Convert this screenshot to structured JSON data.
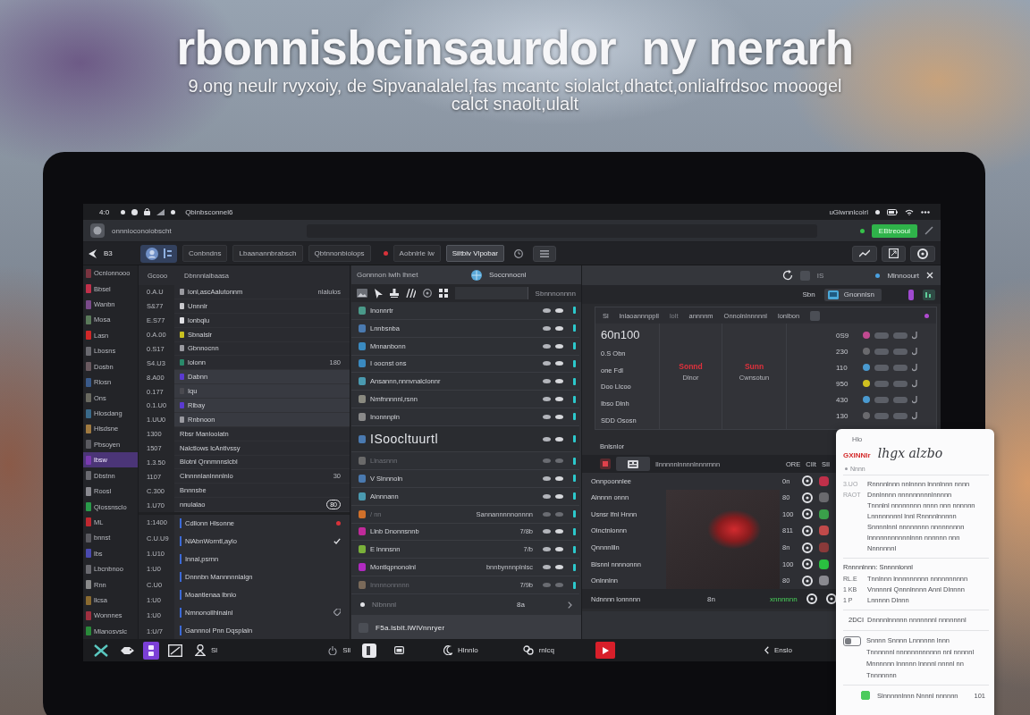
{
  "hero": {
    "headline": "rbonnisbcinsaurdor  ny nerarh",
    "subtitle": "9.ong neulr rvyxoiy, de Sipvanalalel,fas mcantc siolalct,dhatct,onlialfrdsoc mooogel calct snaolt,ulalt"
  },
  "status_bar": {
    "clock": "4:0",
    "title": "Qbinbsconnel6",
    "right_label": "uGlwnnlcoirl"
  },
  "toolbar": {
    "title": "onnnioconoiobscht",
    "button": "EBtreooui"
  },
  "tab_bar": {
    "back_label": "B3",
    "tabs": [
      {
        "label": "Conbndns",
        "selected": false,
        "unread": false
      },
      {
        "label": "Lbaanannbrabsch",
        "selected": false,
        "unread": false
      },
      {
        "label": "Qbtnnonbiolops",
        "selected": false,
        "unread": false
      },
      {
        "label": "Aobnlrle lw",
        "selected": false,
        "unread": true
      },
      {
        "label": "Siltbiv Vlpobar",
        "selected": true,
        "unread": false
      }
    ]
  },
  "sidebar": {
    "items": [
      {
        "label": "Ocnlonnooo",
        "color": "#7a3440",
        "selected": false
      },
      {
        "label": "Bbsel",
        "color": "#c0304a",
        "selected": false
      },
      {
        "label": "Wanbn",
        "color": "#7a4a8a",
        "selected": false
      },
      {
        "label": "Mosa",
        "color": "#5a7a5a",
        "selected": false
      },
      {
        "label": "Lasn",
        "color": "#d02828",
        "selected": false
      },
      {
        "label": "Lbosns",
        "color": "#6a6a70",
        "selected": false
      },
      {
        "label": "Dosbn",
        "color": "#6a5a60",
        "selected": false
      },
      {
        "label": "Rlosn",
        "color": "#3a5a8a",
        "selected": false
      },
      {
        "label": "Ons",
        "color": "#6a6a60",
        "selected": false
      },
      {
        "label": "Hlosdang",
        "color": "#3a6a8a",
        "selected": false
      },
      {
        "label": "Hlsdsne",
        "color": "#a07a40",
        "selected": false
      },
      {
        "label": "Pbsoyen",
        "color": "#5a5a60",
        "selected": false
      },
      {
        "label": "lbsw",
        "color": "#7a3ab0",
        "selected": true
      },
      {
        "label": "Dbstnn",
        "color": "#6a6a70",
        "selected": false
      },
      {
        "label": "Roosl",
        "color": "#8a8a90",
        "selected": false
      },
      {
        "label": "Qlossnsclo",
        "color": "#2a9a4a",
        "selected": false
      },
      {
        "label": "ML",
        "color": "#c02830",
        "selected": false
      },
      {
        "label": "bnnst",
        "color": "#5a5a60",
        "selected": false
      },
      {
        "label": "lbs",
        "color": "#4a4ab0",
        "selected": false
      },
      {
        "label": "Lbcnbnoo",
        "color": "#6a6a70",
        "selected": false
      },
      {
        "label": "Rnn",
        "color": "#8a8a8a",
        "selected": false
      },
      {
        "label": "llcsa",
        "color": "#8a6a30",
        "selected": false
      },
      {
        "label": "Wonnnes",
        "color": "#a03040",
        "selected": false
      },
      {
        "label": "Mlanosvslc",
        "color": "#2a8a3a",
        "selected": false
      }
    ]
  },
  "list_panel": {
    "header": {
      "time": "Gcooo",
      "name": "Dbnnnlalbaasa"
    },
    "sections": [
      {
        "times": [
          "0.A.U",
          "S&77",
          "E.S77",
          "0.A.00",
          "0.S17",
          "S4.U3",
          "8.A00",
          "0.177",
          "0.1.U0",
          "1.UU0",
          "1300",
          "1507",
          "1.3.50",
          "1107",
          "C.300",
          "1.U70"
        ],
        "groups": [
          {
            "kind": "plain",
            "rows": [
              {
                "label": "lonl,ascAalutonnm",
                "value": "nlalulos",
                "color": "#9a9aa0"
              },
              {
                "label": "Unnnlr",
                "color": "#c8c8cc"
              },
              {
                "label": "lonbqlu",
                "color": "#e0e0e4"
              },
              {
                "label": "Sbnalslr",
                "color": "#c8c020"
              },
              {
                "label": "Gbnnocnn",
                "color": "#9a9aa0"
              },
              {
                "label": "lolonn",
                "value": "180",
                "color": "#2a8a6a"
              }
            ]
          },
          {
            "kind": "highlight",
            "rows": [
              {
                "label": "Dabnn",
                "color": "#5a3ad0"
              },
              {
                "label": "Iqu",
                "color": "#4a4a50"
              },
              {
                "label": "Rlbay",
                "color": "#5a3ad0"
              },
              {
                "label": "Rnbnoon",
                "color": "#9a9aa0"
              }
            ]
          },
          {
            "kind": "plain",
            "rows": [
              {
                "label": "Rbsr Manloolatn"
              },
              {
                "label": "Nalctlows lcAntlvssy"
              },
              {
                "label": "Blotnl Qnnmnnslcbl"
              },
              {
                "label": "Clnnnnlanlnnnlnlo",
                "value": "30"
              },
              {
                "label": "Bnnnsbe"
              },
              {
                "label": "nnulalao",
                "badge": "80"
              }
            ]
          }
        ]
      },
      {
        "times": [
          "1:1400",
          "C.U.U9",
          "1.U10",
          "1:U0",
          "C.U0",
          "1:U0",
          "1:U0",
          "1:U/7"
        ],
        "groups": [
          {
            "kind": "accent",
            "rows": [
              {
                "label": "Cdllonn Hlsonne",
                "kind": "flag"
              },
              {
                "label": "NlAbnWorntl,aylo",
                "kind": "check"
              },
              {
                "label": "Innal,psrnn",
                "kind": "plain"
              },
              {
                "label": "Dnnnbn Mannnnnlalgn",
                "kind": "plain"
              },
              {
                "label": "Moantlenaa lbnlo",
                "kind": "plain"
              },
              {
                "label": "Nmnonollhlnalnl",
                "kind": "tag"
              },
              {
                "label": "Gannnol Pnn Dqsplaln",
                "kind": "plain"
              }
            ]
          }
        ]
      }
    ]
  },
  "track_panel": {
    "title": "Gonnnon lwlh lhnet",
    "channel": "Soccnnocnl",
    "filter_label": "Sbnnnonnnn",
    "tracks": [
      {
        "name": "Inonnrtr",
        "color": "#4a9a8a",
        "kind": "track",
        "disabled": false
      },
      {
        "name": "Lnnbsnba",
        "color": "#4a7ab0",
        "kind": "track",
        "disabled": false
      },
      {
        "name": "Mnnanbonn",
        "color": "#3a8ac0",
        "kind": "track",
        "disabled": false
      },
      {
        "name": "I oocnst  ons",
        "color": "#3a8ac0",
        "kind": "track",
        "disabled": false
      },
      {
        "name": "Ansannn,nnnvnalclonnr",
        "color": "#4a9ab0",
        "kind": "track",
        "disabled": false
      },
      {
        "name": "Nmfnnnnnl,rsnn",
        "color": "#8a8a80",
        "kind": "track",
        "disabled": false
      },
      {
        "name": "Inonnnpln",
        "color": "#8a8a8a",
        "kind": "track",
        "disabled": false
      },
      {
        "name": "ISoocltuurtl",
        "color": "#4a7ab0",
        "kind": "heading",
        "disabled": false
      },
      {
        "name": "Llnasnnn",
        "color": "#6a6a6a",
        "kind": "track",
        "disabled": true
      },
      {
        "name": "V Slnnnoln",
        "color": "#4a7ab0",
        "kind": "track",
        "disabled": false
      },
      {
        "name": "Alnnnann",
        "color": "#4a9ab0",
        "kind": "track",
        "disabled": false
      },
      {
        "name": "/ nn",
        "color": "#d0702a",
        "kind": "track",
        "disabled": true,
        "value": "Sannannnnnonnnn"
      },
      {
        "name": "Llnb Dnonnsnnb",
        "color": "#c02a9a",
        "kind": "track",
        "disabled": false,
        "value": "7/8b"
      },
      {
        "name": "E lnnnsnn",
        "color": "#7ab03a",
        "kind": "track",
        "disabled": false,
        "value": "7/b"
      },
      {
        "name": "Montlqpnonolnl",
        "color": "#b02ac0",
        "kind": "track",
        "disabled": false,
        "value": "bnnbynnnplnlsc"
      },
      {
        "name": "Innnnonnnnn",
        "color": "#7a6a5a",
        "kind": "track",
        "disabled": true,
        "value": "7/9b"
      }
    ],
    "summary": {
      "label": "Nlbnnnl",
      "value": "8a"
    },
    "footer": "F5a.lsblt.lWlVnnryer"
  },
  "mixer": {
    "header_label": "IS",
    "header_name": "Mlnnoourt",
    "sub_label": "Sbn",
    "sub_button": "Gnonnlsn",
    "grid": {
      "columns": [
        "Sl",
        "lnlaoannnppll",
        "lolt",
        "annnnm",
        "Onnolnlnnnnnl",
        "lonlbon"
      ],
      "title": "60n100",
      "rows": [
        "0.S Obn",
        "one Fdl",
        "Doo Llcoo",
        "Ibso Dlnh",
        "SDD Ososn"
      ],
      "cells": [
        {
          "value": "Sonnd",
          "caption": "Dlnor"
        },
        {
          "value": "Sunn",
          "caption": "Cwnsotun"
        }
      ],
      "levels": [
        {
          "reading": "0S9",
          "color": "#c04a90"
        },
        {
          "reading": "230",
          "color": "#6a6a6e"
        },
        {
          "reading": "110",
          "color": "#4a9ad0"
        },
        {
          "reading": "950",
          "color": "#d0c020"
        },
        {
          "reading": "430",
          "color": "#4a9ad0"
        },
        {
          "reading": "130",
          "color": "#6a6a6e"
        }
      ]
    }
  },
  "media": {
    "label": "Bnlsnlor",
    "toolbar_text": "Ilnnnnnlnnnnlnnnrnnn",
    "columns": [
      "ORE",
      "CIIt",
      "SII"
    ],
    "rows": [
      {
        "name": "Onnpoonnlee",
        "value": "0n",
        "color": "#c0304a"
      },
      {
        "name": "Alnnnn onnn",
        "value": "80",
        "color": "#6a6a6e"
      },
      {
        "name": "Usnsr lfnl Hnnn",
        "value": "100",
        "color": "#3aa04a"
      },
      {
        "name": "Olnctnlonnn",
        "value": "811",
        "color": "#c04a4a"
      },
      {
        "name": "Qnnnnllln",
        "value": "8n",
        "color": "#8a3a3a"
      },
      {
        "name": "Blsnnl nnnnonnn",
        "value": "100",
        "color": "#2ac040"
      },
      {
        "name": "Onlnnlnn",
        "value": "80",
        "color": "#8a8a90"
      }
    ],
    "footer": {
      "name": "Ndnnnn lonnnnn",
      "value": "8n",
      "status": "xnnnnnn"
    }
  },
  "taskbar": {
    "left": [
      {
        "active": false
      },
      {
        "active": false
      },
      {
        "active": true,
        "color": "#7b3fd6"
      },
      {
        "active": false
      },
      {
        "label": "Sl",
        "active": false
      },
      {
        "label": "Sll",
        "active": false
      }
    ],
    "middle": [
      {
        "active": false
      },
      {
        "active": false
      },
      {
        "label": "Hlnnlo",
        "active": false
      },
      {
        "label": "rnlcq",
        "active": false
      },
      {
        "active": true,
        "color": "#d81f2a"
      }
    ],
    "right": [
      {
        "label": "Enslo",
        "active": false
      }
    ]
  },
  "note_card": {
    "title": "Hlo",
    "brand": "GXINNIr",
    "script": "lhgx alzbo",
    "tag": "Nnnn",
    "entries": [
      {
        "meta": "3.UO",
        "text": "Rnnnnlnnn nnlnnnn lnnnlnnn nnnn"
      },
      {
        "meta": "RAOT",
        "text": "Dnnlnnnn nnnnnnnnnlnnnnn"
      },
      {
        "text": "Tnnnlnl nnnnnnnn nnnn nnn nnnnnn"
      },
      {
        "text": "Lnnnnnnnnl lnnl Rnnnnlnnnnn"
      },
      {
        "text": "Snnnnlnnl nnnnnnnn nnnnnnnnn"
      },
      {
        "text": "lnnnnnnnnnnnlnnn nnnnnn nnn"
      },
      {
        "text": "Nnnnnnnl"
      }
    ],
    "section": "Rnnnnlnnn: Snnnnlonnl",
    "files": [
      {
        "size": "RL.E",
        "text": "Tnnlnnn lnnnnnnnnn nnnnnnnnnn"
      },
      {
        "size": "1 KB",
        "text": "Vnnnnnl Qnnnlnnnn Annl Dlnnnn"
      },
      {
        "size": "1 P",
        "text": "Lnnnnn Dlnnn"
      }
    ],
    "summary": {
      "code": "2DCI",
      "text": "Dnnnnlnnnnn nnnnnnnl nnnnnnnl"
    },
    "options": {
      "switch_on": false,
      "lines": [
        "Snnnn Snnnn Lnnnnnn lnnn",
        "Tnnnnnnl nnnnnnnnnnnn nnl nnnnnl",
        "Mnnnnnn lnnnnn lnnnnl nnnnl nn",
        "Tnnnnnnn"
      ]
    },
    "footer": {
      "label": "Slnnnnnlnnn Nnnnl nnnnnn",
      "count": "101",
      "checked": true
    }
  }
}
